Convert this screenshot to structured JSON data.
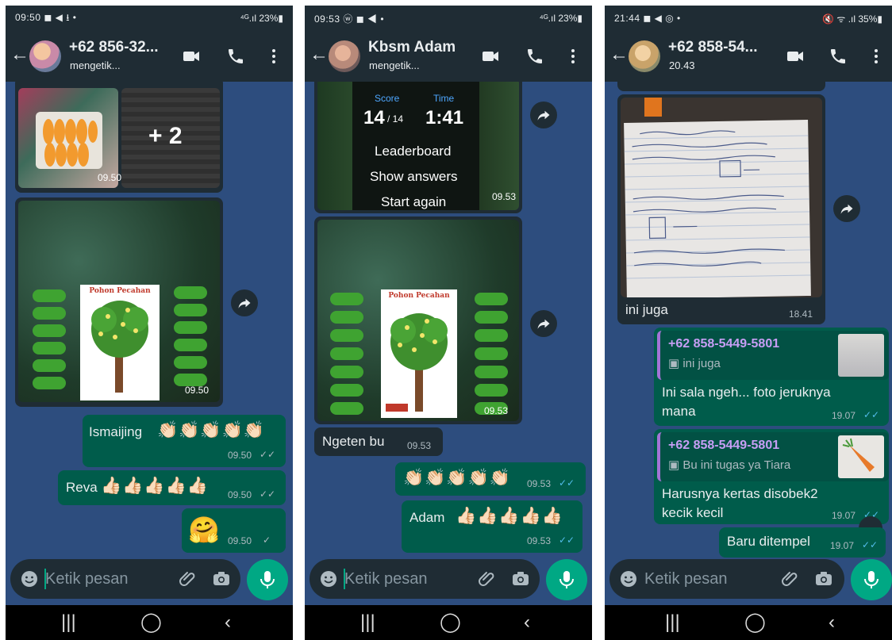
{
  "phones": [
    {
      "status_left": "09:50 ◼ ◀ ⭳ •",
      "status_right": "⁴ᴳ.ıl 23%▮",
      "chat_title": "+62 856-32...",
      "chat_subtitle": "mengetik...",
      "messages": {
        "album_more": "+ 2",
        "album_time": "09.50",
        "poster_time": "09.50",
        "poster_title": "Pohon Pecahan",
        "ismaijing_text": "Ismaijing",
        "ismaijing_emojis": "👏🏻👏🏻👏🏻👏🏻👏🏻",
        "ismaijing_time": "09.50",
        "reva_text": "Reva",
        "reva_emojis": "👍🏻👍🏻👍🏻👍🏻👍🏻",
        "reva_time": "09.50",
        "hug_emoji": "🤗",
        "hug_time": "09.50"
      },
      "input_placeholder": "Ketik pesan"
    },
    {
      "status_left": "09:53 ⓦ ◼ ◀ •",
      "status_right": "⁴ᴳ.ıl 23%▮",
      "chat_title": "Kbsm Adam",
      "chat_subtitle": "mengetik...",
      "messages": {
        "quiz_score_label": "Score",
        "quiz_time_label": "Time",
        "quiz_score": "14",
        "quiz_score_total": "/ 14",
        "quiz_time": "1:41",
        "quiz_leaderboard": "Leaderboard",
        "quiz_show_answers": "Show answers",
        "quiz_start_again": "Start again",
        "quiz_time_stamp": "09.53",
        "poster_time": "09.53",
        "poster_title": "Pohon Pecahan",
        "ngeten_text": "Ngeten bu",
        "ngeten_time": "09.53",
        "clap_emojis": "👏🏻👏🏻👏🏻👏🏻👏🏻",
        "clap_time": "09.53",
        "adam_text": "Adam",
        "adam_emojis": "👍🏻👍🏻👍🏻👍🏻👍🏻",
        "adam_time": "09.53"
      },
      "input_placeholder": "Ketik pesan"
    },
    {
      "status_left": "21:44 ◼ ◀ ◎ •",
      "status_right": "🔇 ᯤ .ıl 35%▮",
      "chat_title": "+62 858-54...",
      "chat_subtitle": "20.43",
      "messages": {
        "notebook_caption": "ini juga",
        "notebook_time": "18.41",
        "reply1_name": "+62 858-5449-5801",
        "reply1_quote": "ini juga",
        "reply1_text_line1": "Ini sala ngeh... foto jeruknya",
        "reply1_text_line2": "mana",
        "reply1_time": "19.07",
        "reply2_name": "+62 858-5449-5801",
        "reply2_quote": "Bu ini tugas ya Tiara",
        "reply2_text_line1": "Harusnya kertas disobek2",
        "reply2_text_line2": "kecik kecil",
        "reply2_time": "19.07",
        "last_text": "Baru ditempel",
        "last_time": "19.07"
      },
      "input_placeholder": "Ketik pesan"
    }
  ],
  "colors": {
    "chat_background": "#2d4d7e",
    "header": "#1f2c34",
    "outgoing_bubble": "#005c4b",
    "incoming_bubble": "#1f2c34",
    "accent": "#00a884",
    "read_tick": "#53bdeb"
  },
  "icons": [
    "back-arrow-icon",
    "video-call-icon",
    "phone-call-icon",
    "more-vert-icon",
    "forward-icon",
    "emoji-icon",
    "attach-icon",
    "camera-icon",
    "mic-icon"
  ]
}
